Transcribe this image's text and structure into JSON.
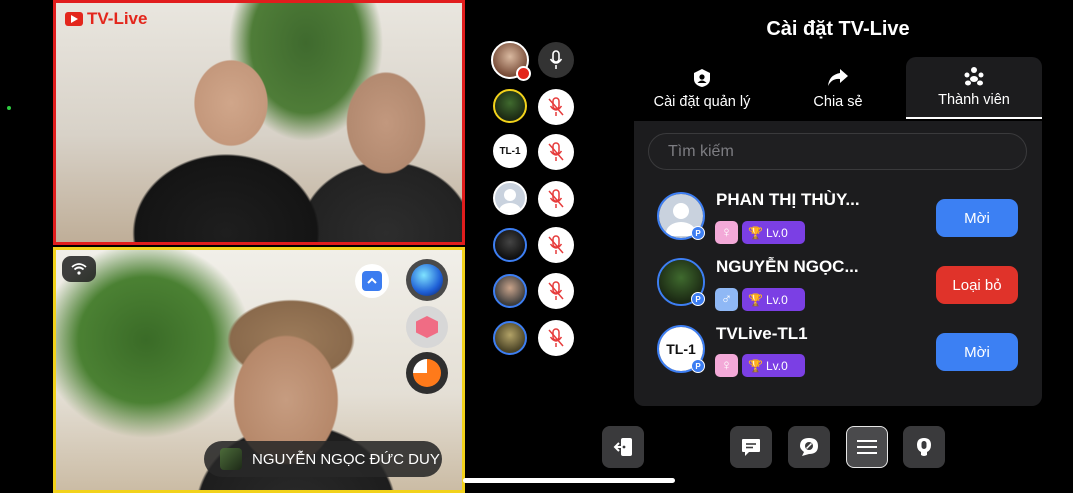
{
  "stream": {
    "brand": "TV-Live",
    "presenter_name": "NGUYỄN NGỌC ĐỨC DUY"
  },
  "participants": [
    {
      "icon": "host-avatar",
      "recording": true,
      "mic": "on"
    },
    {
      "icon": "user-photo-avatar",
      "mic": "muted"
    },
    {
      "icon": "tl1-logo-avatar",
      "label": "TL-1",
      "mic": "muted"
    },
    {
      "icon": "default-avatar",
      "mic": "muted"
    },
    {
      "icon": "user-photo-avatar",
      "mic": "muted"
    },
    {
      "icon": "user-photo-avatar",
      "mic": "muted"
    },
    {
      "icon": "user-photo-avatar",
      "mic": "muted"
    }
  ],
  "panel": {
    "title": "Cài đặt TV-Live",
    "tabs": [
      {
        "label": "Cài đặt quản lý",
        "icon": "admin-icon"
      },
      {
        "label": "Chia sẻ",
        "icon": "share-icon"
      },
      {
        "label": "Thành viên",
        "icon": "members-icon",
        "active": true
      }
    ],
    "search_placeholder": "Tìm kiếm",
    "members": [
      {
        "name": "PHAN THỊ THÙY...",
        "badge": "P",
        "gender": "female",
        "level": "Lv.0",
        "action": "Mời"
      },
      {
        "name": "NGUYỄN NGỌC...",
        "badge": "P",
        "gender": "male",
        "level": "Lv.0",
        "action": "Loại bỏ"
      },
      {
        "name": "TVLive-TL1",
        "badge": "P",
        "avatar_text": "TL-1",
        "gender": "female",
        "level": "Lv.0",
        "action": "Mời"
      }
    ]
  },
  "toolbar": [
    {
      "icon": "exit-icon"
    },
    {
      "icon": "chat-icon"
    },
    {
      "icon": "comment-off-icon"
    },
    {
      "icon": "menu-icon",
      "selected": true
    },
    {
      "icon": "mic-toggle-icon"
    }
  ],
  "colors": {
    "accent_blue": "#3c80f3",
    "danger_red": "#e0332a",
    "level_purple": "#7b3fe4",
    "female_pink": "#f3a9d8",
    "male_blue": "#8fb8f5"
  }
}
